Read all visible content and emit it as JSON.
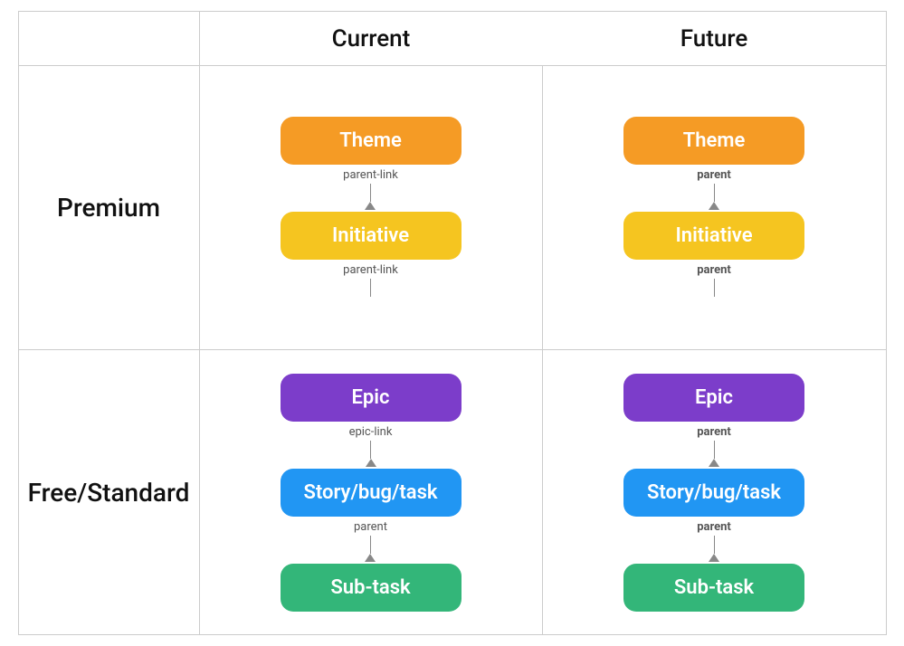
{
  "header": {
    "col1": "Current",
    "col2": "Future"
  },
  "rows": {
    "premium_label": "Premium",
    "free_label": "Free/Standard"
  },
  "current_premium": {
    "top": "Theme",
    "top_color": "orange",
    "link1": "parent-link",
    "link1_bold": false,
    "bottom": "Initiative",
    "bottom_color": "yellow",
    "link2": "parent-link",
    "link2_bold": false
  },
  "future_premium": {
    "top": "Theme",
    "top_color": "orange",
    "link1": "parent",
    "link1_bold": true,
    "bottom": "Initiative",
    "bottom_color": "yellow",
    "link2": "parent",
    "link2_bold": true
  },
  "current_free": {
    "top": "Epic",
    "top_color": "purple",
    "link1": "epic-link",
    "link1_bold": false,
    "middle": "Story/bug/task",
    "middle_color": "blue",
    "link2": "parent",
    "link2_bold": false,
    "bottom": "Sub-task",
    "bottom_color": "green"
  },
  "future_free": {
    "top": "Epic",
    "top_color": "purple",
    "link1": "parent",
    "link1_bold": true,
    "middle": "Story/bug/task",
    "middle_color": "blue",
    "link2": "parent",
    "link2_bold": true,
    "bottom": "Sub-task",
    "bottom_color": "green"
  }
}
